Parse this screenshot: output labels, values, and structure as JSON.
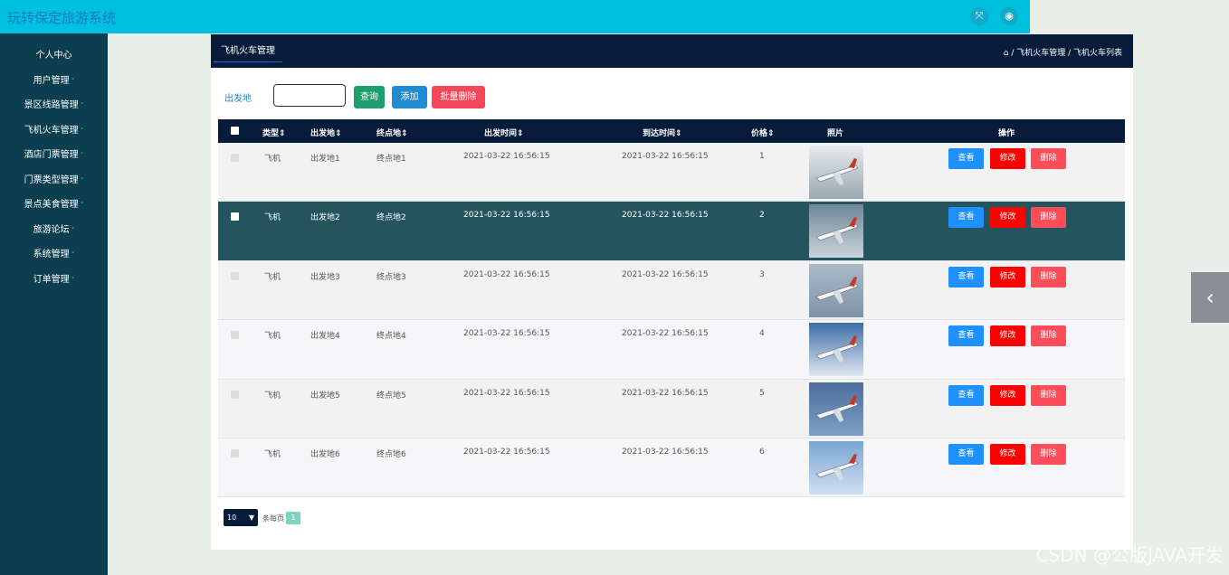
{
  "app": {
    "title": "玩转保定旅游系统"
  },
  "topbar": {
    "fullscreen_icon": "⤧",
    "user_icon": "◉"
  },
  "sidebar": {
    "items": [
      {
        "label": "个人中心",
        "has_caret": false
      },
      {
        "label": "用户管理",
        "has_caret": true
      },
      {
        "label": "景区线路管理",
        "has_caret": true
      },
      {
        "label": "飞机火车管理",
        "has_caret": true
      },
      {
        "label": "酒店门票管理",
        "has_caret": true
      },
      {
        "label": "门票类型管理",
        "has_caret": true
      },
      {
        "label": "景点美食管理",
        "has_caret": true
      },
      {
        "label": "旅游论坛",
        "has_caret": true
      },
      {
        "label": "系统管理",
        "has_caret": true
      },
      {
        "label": "订单管理",
        "has_caret": true
      }
    ]
  },
  "panel": {
    "tab": "飞机火车管理",
    "breadcrumb": "⌂ / 飞机火车管理 / 飞机火车列表"
  },
  "search": {
    "label": "出发地",
    "value": "",
    "query_btn": "查询",
    "add_btn": "添加",
    "batch_delete_btn": "批量删除"
  },
  "table": {
    "columns": {
      "type": "类型⇕",
      "from": "出发地⇕",
      "to": "终点地⇕",
      "depart": "出发时间⇕",
      "arrive": "到达时间⇕",
      "price": "价格⇕",
      "photo": "照片",
      "ops": "操作"
    },
    "actions": {
      "view": "查看",
      "edit": "修改",
      "delete": "删除"
    },
    "rows": [
      {
        "type": "飞机",
        "from": "出发地1",
        "to": "终点地1",
        "depart": "2021-03-22 16:56:15",
        "arrive": "2021-03-22 16:56:15",
        "price": "1"
      },
      {
        "type": "飞机",
        "from": "出发地2",
        "to": "终点地2",
        "depart": "2021-03-22 16:56:15",
        "arrive": "2021-03-22 16:56:15",
        "price": "2"
      },
      {
        "type": "飞机",
        "from": "出发地3",
        "to": "终点地3",
        "depart": "2021-03-22 16:56:15",
        "arrive": "2021-03-22 16:56:15",
        "price": "3"
      },
      {
        "type": "飞机",
        "from": "出发地4",
        "to": "终点地4",
        "depart": "2021-03-22 16:56:15",
        "arrive": "2021-03-22 16:56:15",
        "price": "4"
      },
      {
        "type": "飞机",
        "from": "出发地5",
        "to": "终点地5",
        "depart": "2021-03-22 16:56:15",
        "arrive": "2021-03-22 16:56:15",
        "price": "5"
      },
      {
        "type": "飞机",
        "from": "出发地6",
        "to": "终点地6",
        "depart": "2021-03-22 16:56:15",
        "arrive": "2021-03-22 16:56:15",
        "price": "6"
      }
    ]
  },
  "pager": {
    "page_size": "10",
    "per_page_label": "条每页",
    "current_page": "1"
  },
  "colors": {
    "topbar": "#00c0e0",
    "sidebar": "#0b3e4e",
    "header": "#071c3a",
    "query": "#1e9e6e",
    "add": "#1f8bd1",
    "batch_delete": "#f2485a",
    "view": "#1e90ff",
    "edit": "#ff0000",
    "delete": "#ff4d59"
  },
  "watermark": "CSDN @公版JAVA开发",
  "side_toggle_icon": "‹"
}
